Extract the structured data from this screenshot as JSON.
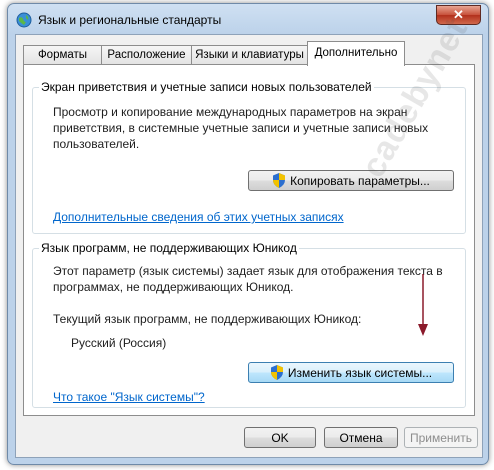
{
  "window": {
    "title": "Язык и региональные стандарты",
    "close_label": "✕"
  },
  "tabs": [
    {
      "label": "Форматы"
    },
    {
      "label": "Расположение"
    },
    {
      "label": "Языки и клавиатуры"
    },
    {
      "label": "Дополнительно"
    }
  ],
  "active_tab": "Дополнительно",
  "welcome_group": {
    "title": "Экран приветствия и учетные записи новых пользователей",
    "description_lines": [
      "Просмотр и копирование международных параметров на экран",
      "приветствия, в системные учетные записи и учетные записи новых",
      "пользователей."
    ],
    "copy_button_label": "Копировать параметры...",
    "link_text": "Дополнительные сведения об этих учетных записях"
  },
  "non_unicode_group": {
    "title": "Язык программ, не поддерживающих Юникод",
    "description_lines": [
      "Этот параметр (язык системы) задает язык для отображения текста в",
      "программах, не поддерживающих Юникод."
    ],
    "current_label": "Текущий язык программ, не поддерживающих Юникод:",
    "current_value": "Русский (Россия)",
    "change_button_label": "Изменить язык системы...",
    "link_text": "Что такое \"Язык системы\"?"
  },
  "footer": {
    "ok_label": "OK",
    "cancel_label": "Отмена",
    "apply_label": "Применить"
  },
  "watermark": "cadebynet",
  "colors": {
    "link": "#0066cc",
    "arrow": "#8b1a2b",
    "focus_border": "#3c7fb1"
  },
  "icons": {
    "title": "globe-icon",
    "button": "uac-shield-icon"
  }
}
